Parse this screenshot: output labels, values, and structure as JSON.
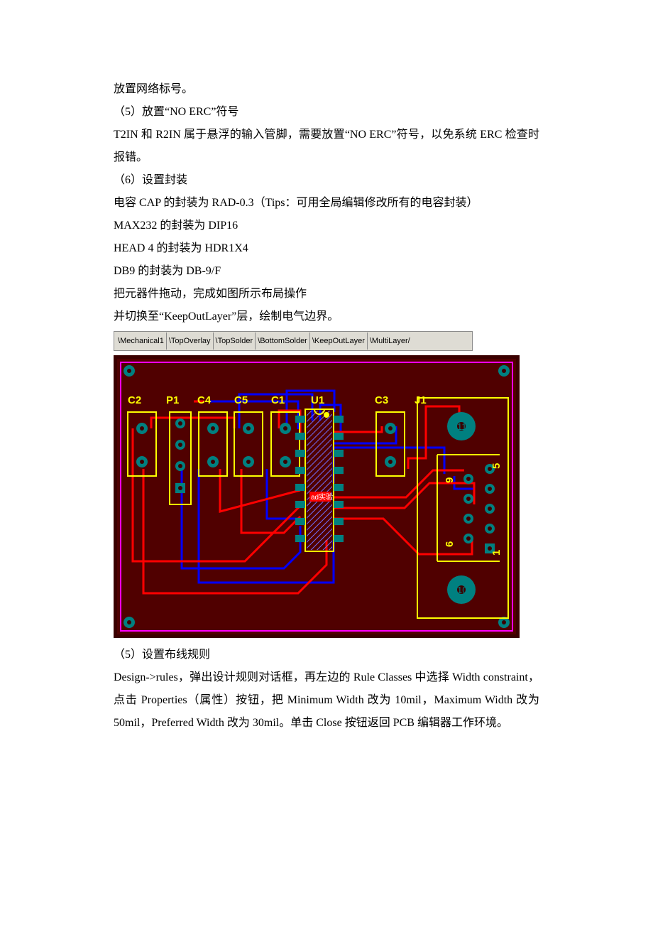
{
  "doc": {
    "p1": "放置网络标号。",
    "p2": "（5）放置“NO ERC”符号",
    "p3": "T2IN 和 R2IN 属于悬浮的输入管脚，需要放置“NO ERC”符号，以免系统 ERC 检查时报错。",
    "p4": "（6）设置封装",
    "p5": "电容 CAP 的封装为 RAD-0.3（Tips：可用全局编辑修改所有的电容封装）",
    "p6": "MAX232 的封装为 DIP16",
    "p7": "HEAD 4 的封装为 HDR1X4",
    "p8": "DB9 的封装为 DB-9/F",
    "p9": "把元器件拖动，完成如图所示布局操作",
    "p10": "并切换至“KeepOutLayer”层，绘制电气边界。",
    "p11": "（5）设置布线规则",
    "p12": "Design->rules，弹出设计规则对话框，再左边的 Rule Classes 中选择 Width constraint，点击 Properties（属性）按钮，把 Minimum Width 改为 10mil，Maximum Width 改为 50mil，Preferred Width 改为 30mil。单击 Close 按钮返回 PCB 编辑器工作环境。"
  },
  "tabs": {
    "t1": "Mechanical1",
    "t2": "TopOverlay",
    "t3": "TopSolder",
    "t4": "BottomSolder",
    "t5": "KeepOutLayer",
    "t6": "MultiLayer"
  },
  "pcb": {
    "designators": {
      "c2": "C2",
      "p1": "P1",
      "c4": "C4",
      "c5": "C5",
      "c1": "C1",
      "u1": "U1",
      "c3": "C3",
      "j1": "J1"
    },
    "pins": {
      "p11": "11",
      "p10": "10",
      "p5": "5",
      "p6": "6",
      "p9": "9",
      "p1": "1"
    },
    "watermark": "ad实验"
  }
}
